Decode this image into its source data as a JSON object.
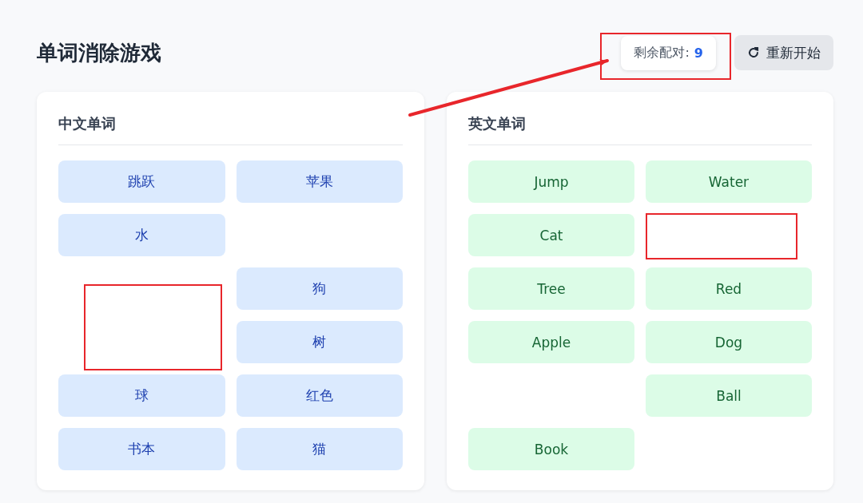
{
  "title": "单词消除游戏",
  "remaining": {
    "label": "剩余配对:",
    "count": "9"
  },
  "restart_button": {
    "label": "重新开始"
  },
  "panels": [
    {
      "kind": "chinese",
      "heading": "中文单词",
      "tiles": [
        {
          "kind": "word",
          "label": "跳跃"
        },
        {
          "kind": "word",
          "label": "苹果"
        },
        {
          "kind": "word",
          "label": "水"
        },
        {
          "kind": "empty"
        },
        {
          "kind": "empty"
        },
        {
          "kind": "word",
          "label": "狗"
        },
        {
          "kind": "empty"
        },
        {
          "kind": "word",
          "label": "树"
        },
        {
          "kind": "word",
          "label": "球"
        },
        {
          "kind": "word",
          "label": "红色"
        },
        {
          "kind": "word",
          "label": "书本"
        },
        {
          "kind": "word",
          "label": "猫"
        }
      ]
    },
    {
      "kind": "english",
      "heading": "英文单词",
      "tiles": [
        {
          "kind": "word",
          "label": "Jump"
        },
        {
          "kind": "word",
          "label": "Water"
        },
        {
          "kind": "word",
          "label": "Cat"
        },
        {
          "kind": "empty"
        },
        {
          "kind": "word",
          "label": "Tree"
        },
        {
          "kind": "word",
          "label": "Red"
        },
        {
          "kind": "word",
          "label": "Apple"
        },
        {
          "kind": "word",
          "label": "Dog"
        },
        {
          "kind": "empty"
        },
        {
          "kind": "word",
          "label": "Ball"
        },
        {
          "kind": "word",
          "label": "Book"
        },
        {
          "kind": "empty"
        }
      ]
    }
  ]
}
